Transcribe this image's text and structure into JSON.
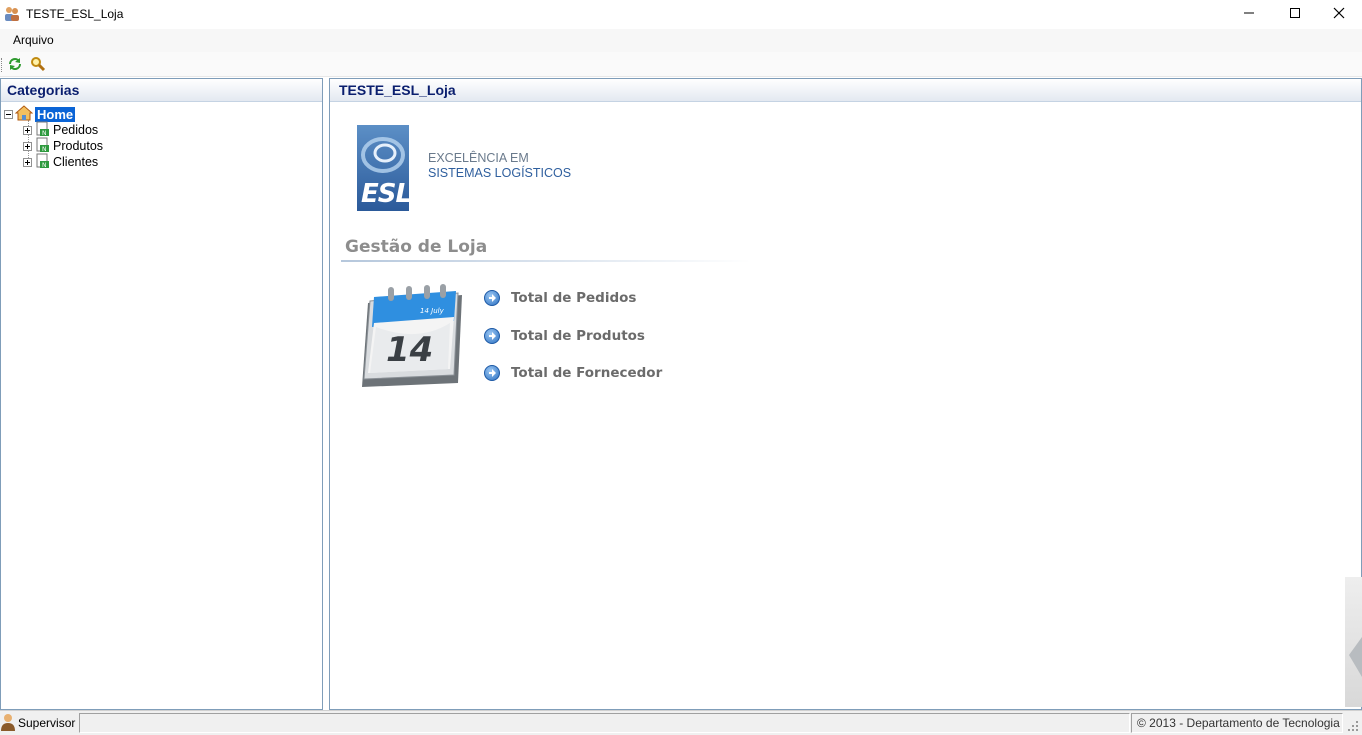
{
  "window": {
    "title": "TESTE_ESL_Loja",
    "app_icon": "users-icon",
    "controls": [
      "minimize-icon",
      "maximize-icon",
      "close-icon"
    ]
  },
  "menu": {
    "items": [
      {
        "label": "Arquivo"
      }
    ]
  },
  "toolbar": {
    "buttons": [
      {
        "icon": "refresh-icon"
      },
      {
        "icon": "search-icon"
      }
    ]
  },
  "left_panel": {
    "title": "Categorias",
    "tree": {
      "root": {
        "label": "Home",
        "icon": "home-icon",
        "expanded": true,
        "selected": true
      },
      "children": [
        {
          "label": "Pedidos",
          "icon": "document-icon",
          "expanded": false
        },
        {
          "label": "Produtos",
          "icon": "document-icon",
          "expanded": false
        },
        {
          "label": "Clientes",
          "icon": "document-icon",
          "expanded": false
        }
      ]
    }
  },
  "main": {
    "title": "TESTE_ESL_Loja",
    "logo": {
      "text": "ESL",
      "tagline_line1": "EXCELÊNCIA EM",
      "tagline_line2": "SISTEMAS LOGÍSTICOS"
    },
    "section_title": "Gestão de Loja",
    "calendar": {
      "day": "14",
      "month": "July"
    },
    "links": [
      {
        "label": "Total de Pedidos",
        "icon": "arrow-circle-icon"
      },
      {
        "label": "Total de Produtos",
        "icon": "arrow-circle-icon"
      },
      {
        "label": "Total de Fornecedor",
        "icon": "arrow-circle-icon"
      }
    ]
  },
  "statusbar": {
    "user": "Supervisor",
    "user_icon": "user-icon",
    "copyright": "© 2013 - Departamento de Tecnologia"
  },
  "colors": {
    "header_text": "#0a1e6e",
    "selection": "#0a64d6",
    "panel_border": "#7f9db9",
    "link_text": "#6b6b6b",
    "logo_blue": "#2b5a9a"
  }
}
